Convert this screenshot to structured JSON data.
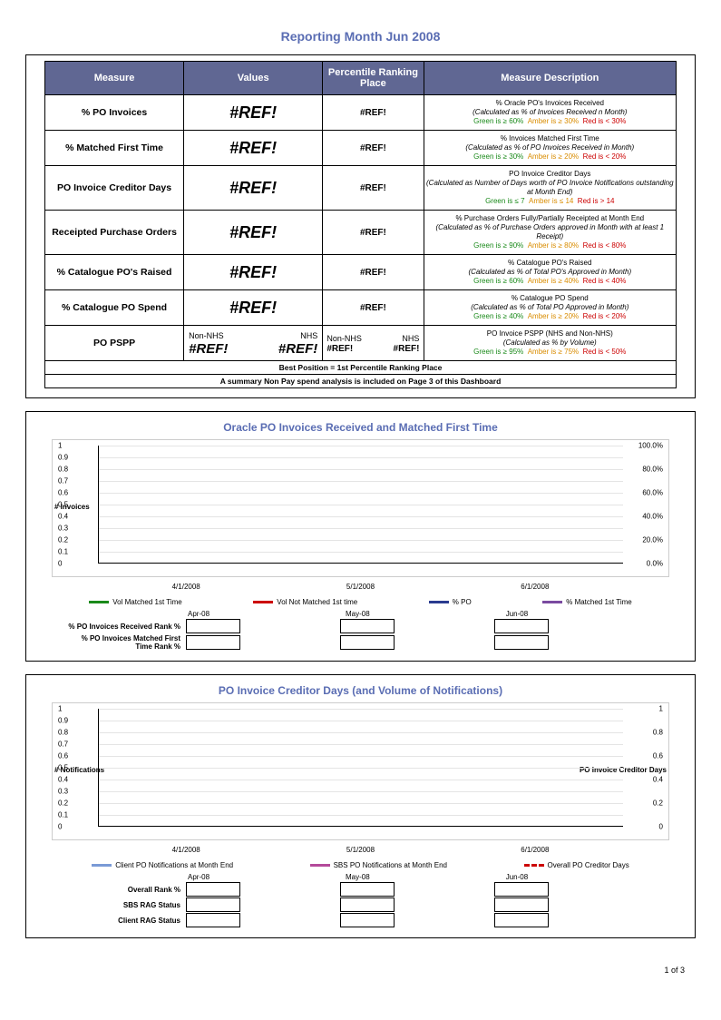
{
  "page_title": "Reporting Month Jun 2008",
  "headers": {
    "c1": "Measure",
    "c2": "Values",
    "c3": "Percentile Ranking Place",
    "c4": "Measure Description"
  },
  "rows": [
    {
      "name": "% PO Invoices",
      "val": "#REF!",
      "rank": "#REF!",
      "t": "% Oracle PO's Invoices Received",
      "c": "(Calculated as % of Invoices Received n Month)",
      "g": "Green is ≥ 60%",
      "a": "Amber is ≥ 30%",
      "r": "Red is < 30%"
    },
    {
      "name": "% Matched First Time",
      "val": "#REF!",
      "rank": "#REF!",
      "t": "% Invoices Matched First Time",
      "c": "(Calculated as % of PO Invoices Received in Month)",
      "g": "Green is ≥ 30%",
      "a": "Amber is ≥ 20%",
      "r": "Red is < 20%"
    },
    {
      "name": "PO Invoice Creditor Days",
      "val": "#REF!",
      "rank": "#REF!",
      "t": "PO Invoice Creditor Days",
      "c": "(Calculated as Number of Days worth of PO Invoice Notifications outstanding at Month End)",
      "g": "Green is ≤ 7",
      "a": "Amber is ≤ 14",
      "r": "Red is > 14"
    },
    {
      "name": "Receipted Purchase Orders",
      "val": "#REF!",
      "rank": "#REF!",
      "t": "% Purchase Orders Fully/Partially Receipted at Month End",
      "c": "(Calculated as % of Purchase Orders approved in Month with at least 1 Receipt)",
      "g": "Green is ≥ 90%",
      "a": "Amber is ≥ 80%",
      "r": "Red is < 80%"
    },
    {
      "name": "% Catalogue PO's Raised",
      "val": "#REF!",
      "rank": "#REF!",
      "t": "% Catalogue PO's Raised",
      "c": "(Calculated as % of Total PO's Approved in Month)",
      "g": "Green is ≥ 60%",
      "a": "Amber is ≥ 40%",
      "r": "Red is < 40%"
    },
    {
      "name": "% Catalogue PO Spend",
      "val": "#REF!",
      "rank": "#REF!",
      "t": "% Catalogue PO Spend",
      "c": "(Calculated as % of Total PO Approved in Month)",
      "g": "Green is ≥ 40%",
      "a": "Amber is ≥ 20%",
      "r": "Red is < 20%"
    }
  ],
  "dual": {
    "name": "PO PSPP",
    "h1": "Non-NHS",
    "h2": "NHS",
    "v1": "#REF!",
    "v2": "#REF!",
    "r1": "#REF!",
    "r2": "#REF!",
    "t": "PO Invoice PSPP (NHS and Non-NHS)",
    "c": "(Calculated as % by Volume)",
    "g": "Green is ≥ 95%",
    "a": "Amber is ≥ 75%",
    "r": "Red is < 50%"
  },
  "footer1": "Best Position = 1st Percentile Ranking Place",
  "footer2": "A summary Non Pay spend analysis is included on Page 3 of this Dashboard",
  "chart1": {
    "title": "Oracle PO Invoices Received and Matched First Time",
    "ylabel": "# Invoices",
    "y2label": "",
    "yticks": [
      "1",
      "0.9",
      "0.8",
      "0.7",
      "0.6",
      "0.5",
      "0.4",
      "0.3",
      "0.2",
      "0.1",
      "0"
    ],
    "y2ticks": [
      "100.0%",
      "80.0%",
      "60.0%",
      "40.0%",
      "20.0%",
      "0.0%"
    ],
    "xticks": [
      "4/1/2008",
      "5/1/2008",
      "6/1/2008"
    ],
    "legend": [
      {
        "c": "#1a8a1a",
        "l": "Vol Matched 1st Time"
      },
      {
        "c": "#cc0000",
        "l": "Vol Not Matched 1st time"
      },
      {
        "c": "#2a3b8f",
        "l": "% PO"
      },
      {
        "c": "#7a4aa0",
        "l": "% Matched 1st Time"
      }
    ],
    "months": [
      "Apr-08",
      "May-08",
      "Jun-08"
    ],
    "ranks": [
      "% PO Invoices Received Rank %",
      "% PO Invoices Matched First Time Rank %"
    ]
  },
  "chart2": {
    "title": "PO Invoice Creditor Days (and Volume of Notifications)",
    "ylabel": "# Notifications",
    "y2label": "PO Invoice Creditor Days",
    "yticks": [
      "1",
      "0.9",
      "0.8",
      "0.7",
      "0.6",
      "0.5",
      "0.4",
      "0.3",
      "0.2",
      "0.1",
      "0"
    ],
    "y2ticks": [
      "1",
      "0.8",
      "0.6",
      "0.4",
      "0.2",
      "0"
    ],
    "xticks": [
      "4/1/2008",
      "5/1/2008",
      "6/1/2008"
    ],
    "legend": [
      {
        "c": "#7a9ad6",
        "l": "Client PO Notifications at Month End"
      },
      {
        "c": "#b44a9a",
        "l": "SBS PO Notifications at Month End"
      },
      {
        "c": "#cc0000",
        "l": "Overall PO Creditor Days",
        "dash": true
      }
    ],
    "months": [
      "Apr-08",
      "May-08",
      "Jun-08"
    ],
    "ranks": [
      "Overall Rank %",
      "SBS RAG Status",
      "Client RAG Status"
    ]
  },
  "chart_data": [
    {
      "type": "bar",
      "title": "Oracle PO Invoices Received and Matched First Time",
      "x": [
        "4/1/2008",
        "5/1/2008",
        "6/1/2008"
      ],
      "series": [
        {
          "name": "Vol Matched 1st Time",
          "values": [
            null,
            null,
            null
          ]
        },
        {
          "name": "Vol Not Matched 1st time",
          "values": [
            null,
            null,
            null
          ]
        },
        {
          "name": "% PO",
          "values": [
            null,
            null,
            null
          ]
        },
        {
          "name": "% Matched 1st Time",
          "values": [
            null,
            null,
            null
          ]
        }
      ],
      "ylim": [
        0,
        1
      ],
      "y2lim": [
        0,
        100
      ],
      "ylabel": "# Invoices",
      "y2label": "%"
    },
    {
      "type": "bar",
      "title": "PO Invoice Creditor Days (and Volume of Notifications)",
      "x": [
        "4/1/2008",
        "5/1/2008",
        "6/1/2008"
      ],
      "series": [
        {
          "name": "Client PO Notifications at Month End",
          "values": [
            null,
            null,
            null
          ]
        },
        {
          "name": "SBS PO Notifications at Month End",
          "values": [
            null,
            null,
            null
          ]
        },
        {
          "name": "Overall PO Creditor Days",
          "values": [
            null,
            null,
            null
          ]
        }
      ],
      "ylim": [
        0,
        1
      ],
      "y2lim": [
        0,
        1
      ],
      "ylabel": "# Notifications",
      "y2label": "PO Invoice Creditor Days"
    }
  ],
  "pagenum": "1 of 3"
}
